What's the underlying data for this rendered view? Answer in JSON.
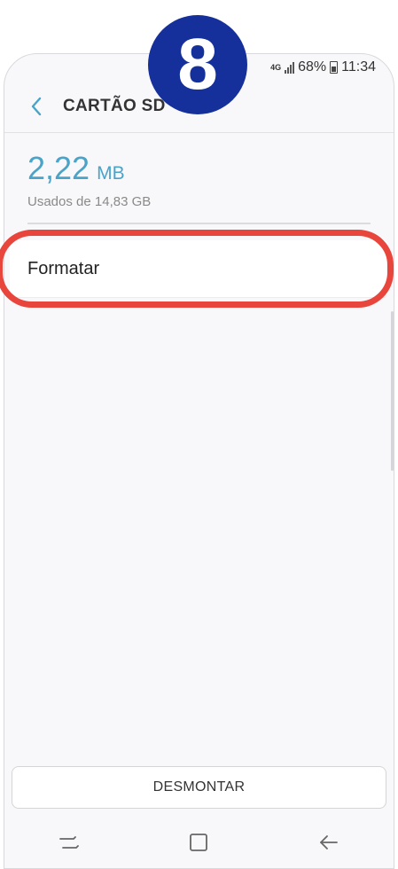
{
  "step": {
    "number": "8"
  },
  "status_bar": {
    "network": "4G",
    "battery": "68%",
    "time": "11:34"
  },
  "header": {
    "back_icon": "chevron-left-icon",
    "title": "CARTÃO SD"
  },
  "storage": {
    "used_value": "2,22",
    "used_unit": "MB",
    "subtitle": "Usados de 14,83 GB",
    "used_fraction": 0.00015
  },
  "menu": {
    "items": [
      {
        "label": "Formatar"
      }
    ]
  },
  "footer": {
    "unmount_label": "DESMONTAR"
  },
  "navigation": {
    "icons": [
      "recent-apps-icon",
      "home-icon",
      "back-arrow-icon"
    ]
  },
  "colors": {
    "accent": "#4aa3c9",
    "highlight": "#e8453c",
    "badge": "#15309a"
  }
}
